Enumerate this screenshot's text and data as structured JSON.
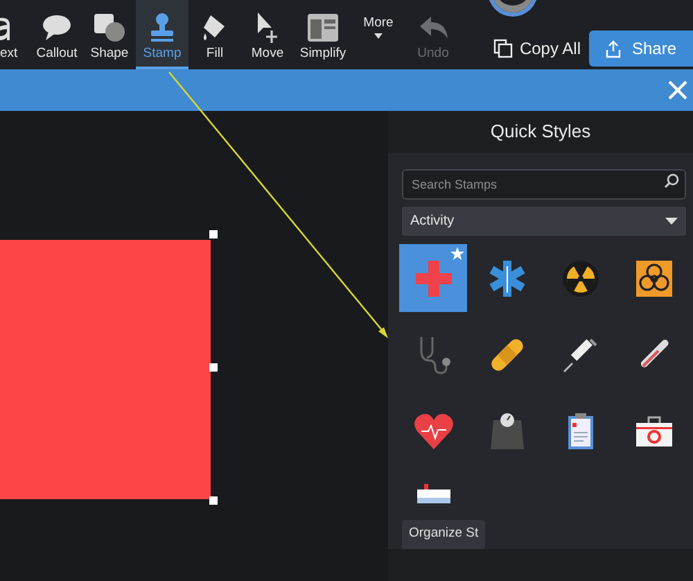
{
  "toolbar": {
    "tools": [
      {
        "kind": "text",
        "label": "ext",
        "selected": false,
        "disabled": false
      },
      {
        "kind": "callout",
        "label": "Callout",
        "selected": false,
        "disabled": false
      },
      {
        "kind": "shape",
        "label": "Shape",
        "selected": false,
        "disabled": false
      },
      {
        "kind": "stamp",
        "label": "Stamp",
        "selected": true,
        "disabled": false
      },
      {
        "kind": "fill",
        "label": "Fill",
        "selected": false,
        "disabled": false
      },
      {
        "kind": "move",
        "label": "Move",
        "selected": false,
        "disabled": false
      },
      {
        "kind": "simplify",
        "label": "Simplify",
        "selected": false,
        "disabled": false
      },
      {
        "kind": "more",
        "label": "More",
        "selected": false,
        "disabled": false
      },
      {
        "kind": "undo",
        "label": "Undo",
        "selected": false,
        "disabled": true
      }
    ],
    "copy_all": "Copy All",
    "share": "Share"
  },
  "quick_styles": {
    "title": "Quick Styles",
    "search": {
      "placeholder": "Search Stamps"
    },
    "category": "Activity",
    "stamps": [
      {
        "kind": "cross",
        "selected": true,
        "favorite": true
      },
      {
        "kind": "star-of-life",
        "selected": false,
        "favorite": false
      },
      {
        "kind": "radiation",
        "selected": false,
        "favorite": false
      },
      {
        "kind": "biohazard",
        "selected": false,
        "favorite": false
      },
      {
        "kind": "stethoscope",
        "selected": false,
        "favorite": false
      },
      {
        "kind": "bandage",
        "selected": false,
        "favorite": false
      },
      {
        "kind": "syringe",
        "selected": false,
        "favorite": false
      },
      {
        "kind": "thermometer",
        "selected": false,
        "favorite": false
      },
      {
        "kind": "heart",
        "selected": false,
        "favorite": false
      },
      {
        "kind": "scale",
        "selected": false,
        "favorite": false
      },
      {
        "kind": "clipboard",
        "selected": false,
        "favorite": false
      },
      {
        "kind": "first-aid-kit",
        "selected": false,
        "favorite": false
      },
      {
        "kind": "sign",
        "selected": false,
        "favorite": false
      }
    ],
    "organize_button": "Organize St"
  }
}
